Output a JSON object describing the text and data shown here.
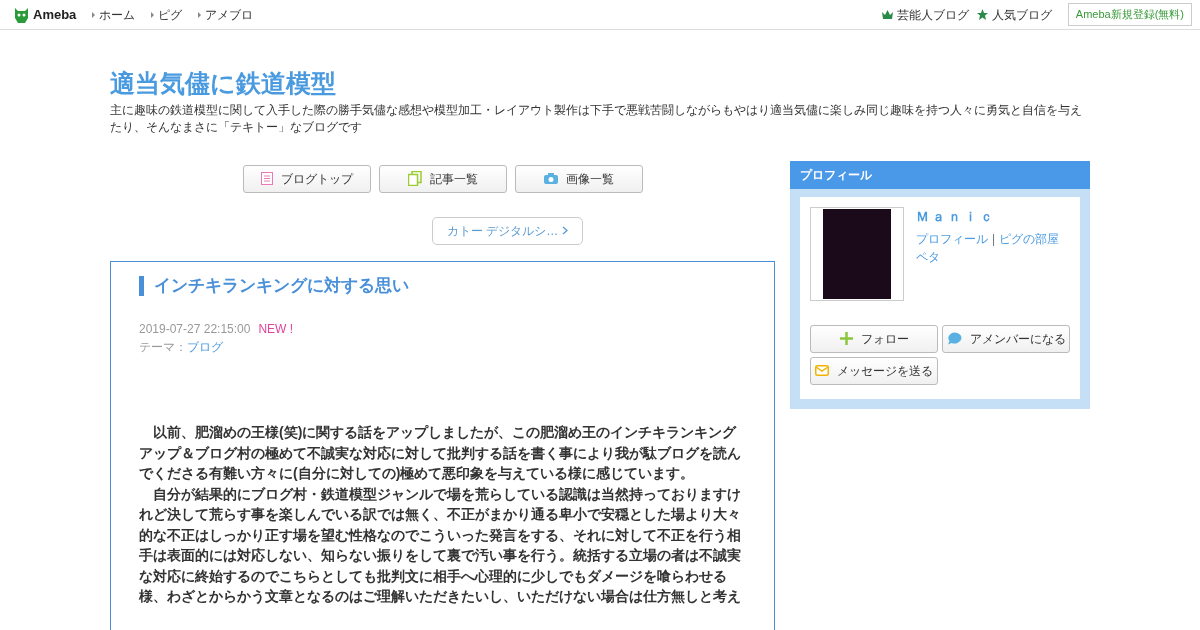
{
  "header": {
    "logo": "Ameba",
    "nav": [
      "ホーム",
      "ピグ",
      "アメブロ"
    ],
    "right_links": [
      {
        "kind": "crown",
        "label": "芸能人ブログ"
      },
      {
        "kind": "star",
        "label": "人気ブログ"
      }
    ],
    "signup": "Ameba新規登録(無料)"
  },
  "blog": {
    "title": "適当気儘に鉄道模型",
    "description": "主に趣味の鉄道模型に関して入手した際の勝手気儘な感想や模型加工・レイアウト製作は下手で悪戦苦闘しながらもやはり適当気儘に楽しみ同じ趣味を持つ人々に勇気と自信を与えたり、そんなまさに「テキトー」なブログです"
  },
  "blog_nav": [
    {
      "kind": "list",
      "label": "ブログトップ"
    },
    {
      "kind": "pages",
      "label": "記事一覧"
    },
    {
      "kind": "camera",
      "label": "画像一覧"
    }
  ],
  "next_link": "カトー デジタルシ…",
  "article": {
    "title": "インチキランキングに対する思い",
    "date": "2019-07-27 22:15:00",
    "new_badge": "NEW !",
    "theme_label": "テーマ：",
    "theme": "ブログ",
    "paragraphs": [
      "以前、肥溜めの王様(笑)に関する話をアップしましたが、この肥溜め王のインチキランキングアップ＆ブログ村の極めて不誠実な対応に対して批判する話を書く事により我が駄ブログを読んでくださる有難い方々に(自分に対しての)極めて悪印象を与えている様に感じています。",
      "自分が結果的にブログ村・鉄道模型ジャンルで場を荒らしている認識は当然持っておりますけれど決して荒らす事を楽しんでいる訳では無く、不正がまかり通る卑小で安穏とした場より大々的な不正はしっかり正す場を望む性格なのでこういった発言をする、それに対して不正を行う相手は表面的には対応しない、知らない振りをして裏で汚い事を行う。統括する立場の者は不誠実な対応に終始するのでこちらとしても批判文に相手へ心理的に少しでもダメージを喰らわせる様、わざとからかう文章となるのはご理解いただきたいし、いただけない場合は仕方無しと考え"
    ]
  },
  "profile": {
    "heading": "プロフィール",
    "name": "Ｍａｎｉｃ",
    "links": [
      "プロフィール",
      "ピグの部屋"
    ],
    "separator": "|",
    "link2": "ペタ",
    "buttons": [
      {
        "kind": "follow",
        "label": "フォロー"
      },
      {
        "kind": "amember",
        "label": "アメンバーになる"
      },
      {
        "kind": "message",
        "label": "メッセージを送る"
      }
    ]
  }
}
